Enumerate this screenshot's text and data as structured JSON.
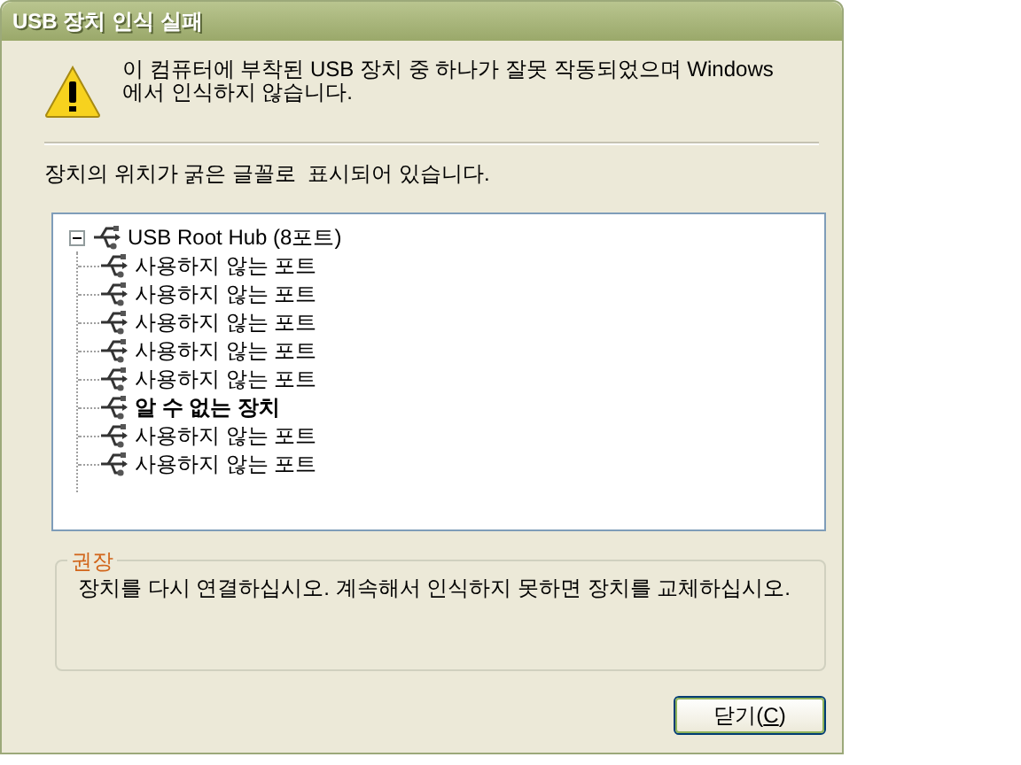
{
  "window": {
    "title": "USB 장치 인식 실패"
  },
  "message": "이 컴퓨터에 부착된 USB 장치 중 하나가 잘못 작동되었으며 Windows 에서 인식하지 않습니다.",
  "hint": "장치의 위치가 굵은 글꼴로  표시되어 있습니다.",
  "tree": {
    "label": "USB Root Hub (8포트)",
    "expanded": true,
    "children": [
      {
        "label": "사용하지 않는 포트",
        "bold": false
      },
      {
        "label": "사용하지 않는 포트",
        "bold": false
      },
      {
        "label": "사용하지 않는 포트",
        "bold": false
      },
      {
        "label": "사용하지 않는 포트",
        "bold": false
      },
      {
        "label": "사용하지 않는 포트",
        "bold": false
      },
      {
        "label": "알 수 없는 장치",
        "bold": true
      },
      {
        "label": "사용하지 않는 포트",
        "bold": false
      },
      {
        "label": "사용하지 않는 포트",
        "bold": false
      }
    ]
  },
  "recommendation": {
    "title": "권장",
    "text": "장치를 다시 연결하십시오. 계속해서 인식하지 못하면 장치를 교체하십시오."
  },
  "close_button": {
    "label_before": "닫기(",
    "access_key": "C",
    "label_after": ")"
  }
}
